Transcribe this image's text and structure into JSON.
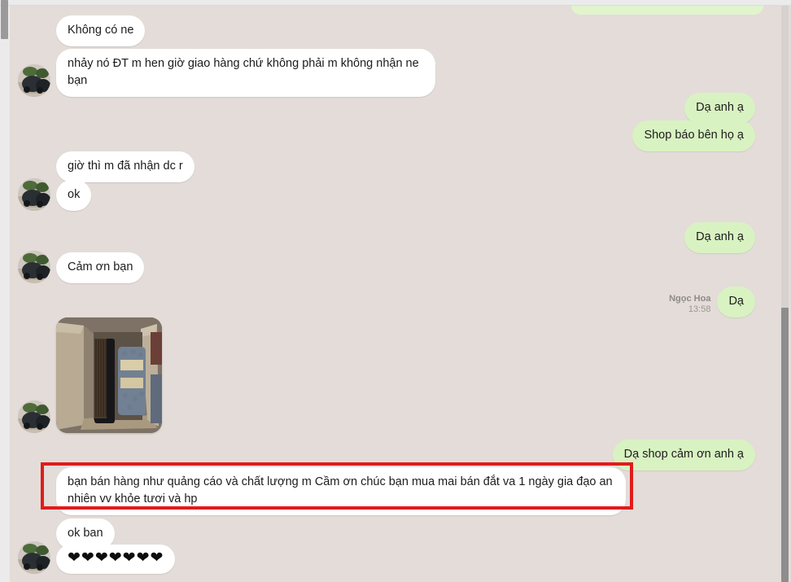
{
  "window": {
    "background_color": "#e3dcd8",
    "incoming_bubble_color": "#ffffff",
    "outgoing_bubble_color": "#d9f2c2",
    "annotation_color": "#e01b1b"
  },
  "conversation": {
    "messages": [
      {
        "id": "m0",
        "side": "out",
        "text": "",
        "partial": true
      },
      {
        "id": "m1",
        "side": "in",
        "text": "Không có ne"
      },
      {
        "id": "m2",
        "side": "in",
        "text": "nhảy nó ĐT m hen giờ giao hàng chứ không phải m không nhận ne bạn"
      },
      {
        "id": "m3",
        "side": "out",
        "text": "Dạ anh ạ"
      },
      {
        "id": "m4",
        "side": "out",
        "text": "Shop báo bên họ ạ"
      },
      {
        "id": "m5",
        "side": "in",
        "text": "giờ thì m đã nhận dc r"
      },
      {
        "id": "m6",
        "side": "in",
        "text": "ok"
      },
      {
        "id": "m7",
        "side": "out",
        "text": "Dạ anh ạ"
      },
      {
        "id": "m8",
        "side": "in",
        "text": "Cảm ơn bạn"
      },
      {
        "id": "m9",
        "side": "out",
        "text": "Dạ",
        "sender": "Ngọc Hoa",
        "time": "13:58"
      },
      {
        "id": "m10",
        "side": "in",
        "type": "image",
        "alt": "open-cardboard-box-with-brush-and-wrapped-items"
      },
      {
        "id": "m11",
        "side": "out",
        "text": "Dạ shop cảm ơn anh ạ"
      },
      {
        "id": "m12",
        "side": "in",
        "text": "bạn bán hàng như quảng cáo và chất lượng m Cầm ơn chúc bạn mua mai bán đắt va 1 ngày gia đạo an nhiên vv khỏe tươi và hp",
        "highlighted": true
      },
      {
        "id": "m13",
        "side": "in",
        "text": "ok ban"
      },
      {
        "id": "m14",
        "side": "in",
        "text": "❤❤❤❤❤❤❤"
      }
    ]
  }
}
